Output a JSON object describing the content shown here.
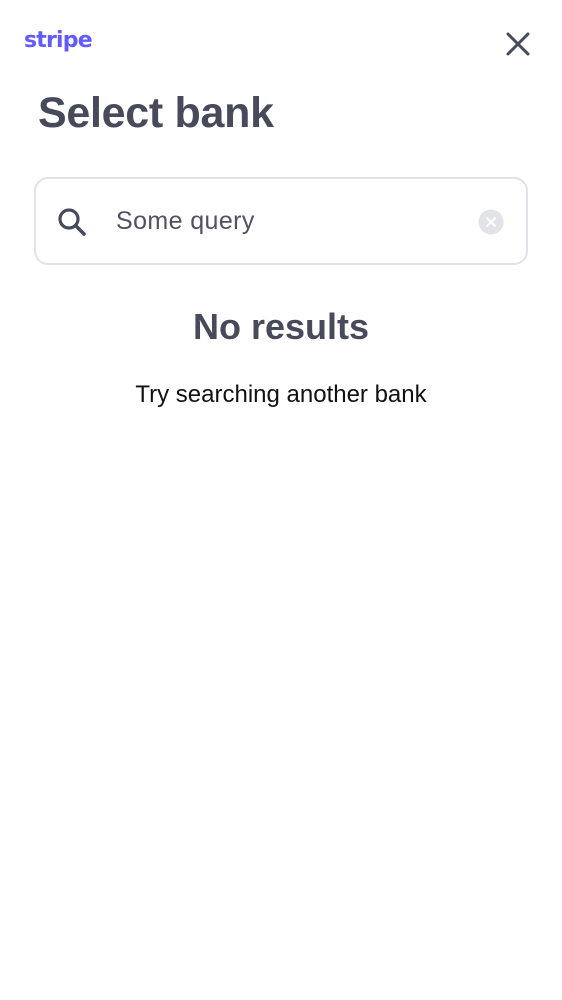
{
  "header": {
    "logo_text": "stripe",
    "brand_color": "#635bff",
    "close_icon": "close-icon"
  },
  "page": {
    "title": "Select bank"
  },
  "search": {
    "value": "Some query",
    "search_icon": "search-icon",
    "clear_icon": "clear-circle-icon"
  },
  "empty_state": {
    "title": "No results",
    "hint": "Try searching another bank"
  },
  "colors": {
    "title_text": "#474a5a",
    "body_text": "#111111",
    "border": "#e2e3e8",
    "icon": "#474a5a",
    "clear_icon_bg": "#e2e3e8"
  }
}
